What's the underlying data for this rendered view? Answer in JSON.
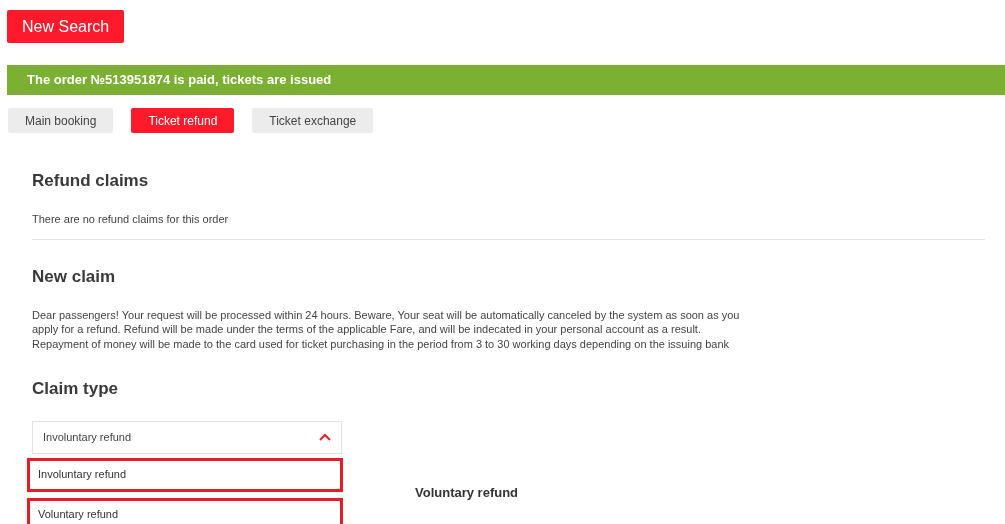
{
  "new_search_button": "New Search",
  "status_banner": "The order №513951874 is paid, tickets are issued",
  "tabs": [
    {
      "label": "Main booking",
      "selected": false
    },
    {
      "label": "Ticket refund",
      "selected": true
    },
    {
      "label": "Ticket exchange",
      "selected": false
    }
  ],
  "refund_claims": {
    "title": "Refund claims",
    "message": "There are no refund claims for this order"
  },
  "new_claim": {
    "title": "New claim",
    "notice": "Dear passengers! Your request will be processed within 24 hours. Beware, Your seat will be automatically canceled by the system as soon as you apply for a refund. Refund will be made under the terms of the applicable Fare, and will be indecated in your personal account as a result. Repayment of money will be made to the card used for ticket purchasing in the period from 3 to 30 working days depending on the issuing bank"
  },
  "claim_type": {
    "title": "Claim type",
    "value": "Involuntary refund",
    "expanded": true,
    "options": [
      {
        "label": "Involuntary refund",
        "outlined": true
      },
      {
        "label": "Voluntary refund",
        "outlined": true
      }
    ]
  },
  "section_heading": "Voluntary refund"
}
